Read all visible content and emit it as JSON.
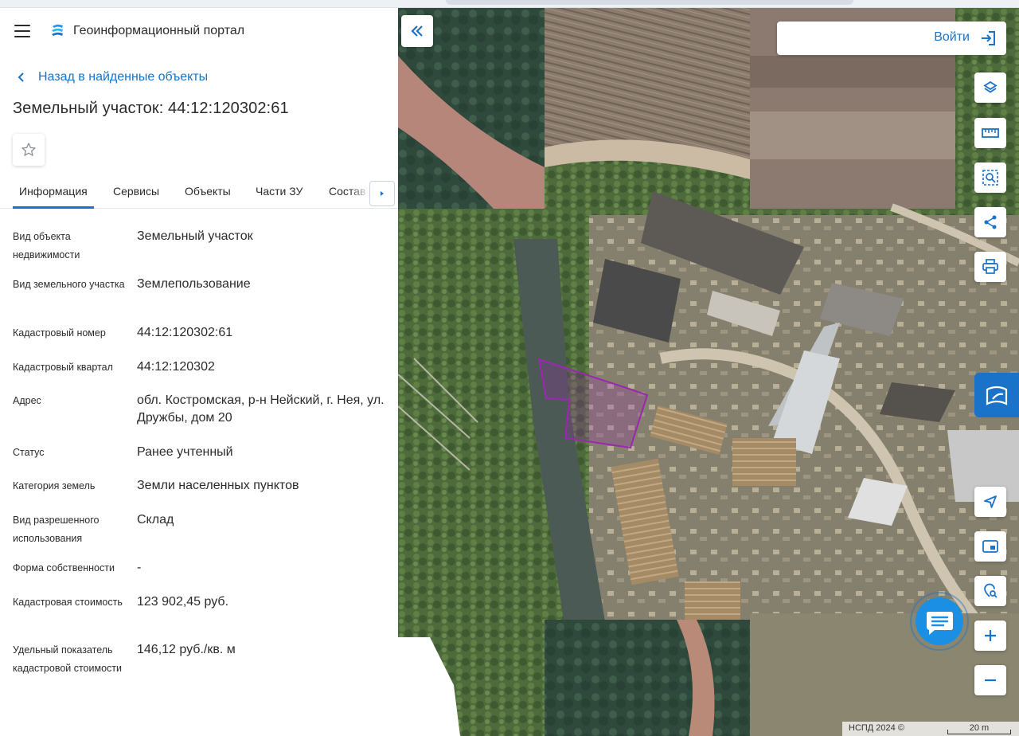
{
  "app": {
    "title": "Геоинформационный портал"
  },
  "panel": {
    "back_label": "Назад в найденные объекты",
    "object_title": "Земельный участок: 44:12:120302:61",
    "tabs": [
      {
        "label": "Информация",
        "active": true
      },
      {
        "label": "Сервисы",
        "active": false
      },
      {
        "label": "Объекты",
        "active": false
      },
      {
        "label": "Части ЗУ",
        "active": false
      },
      {
        "label": "Состав",
        "active": false
      }
    ],
    "info_rows": [
      {
        "label": "Вид объекта недвижимости",
        "value": "Земельный участок"
      },
      {
        "label": "Вид земельного участка",
        "value": "Землепользование"
      },
      {
        "label": "Кадастровый номер",
        "value": "44:12:120302:61"
      },
      {
        "label": "Кадастровый квартал",
        "value": "44:12:120302"
      },
      {
        "label": "Адрес",
        "value": "обл. Костромская, р-н Нейский, г. Нея, ул. Дружбы, дом 20"
      },
      {
        "label": "Статус",
        "value": "Ранее учтенный"
      },
      {
        "label": "Категория земель",
        "value": "Земли населенных пунктов"
      },
      {
        "label": "Вид разрешенного использования",
        "value": "Склад"
      },
      {
        "label": "Форма собственности",
        "value": "-"
      },
      {
        "label": "Кадастровая стоимость",
        "value": "123 902,45 руб."
      },
      {
        "label": "Удельный показатель кадастровой стоимости",
        "value": "146,12 руб./кв. м"
      }
    ]
  },
  "map": {
    "login_label": "Войти",
    "tools": [
      "layers-icon",
      "ruler-icon",
      "area-search-icon",
      "share-icon",
      "print-icon"
    ],
    "nav_tools": [
      "location-arrow-icon",
      "picture-in-picture-icon",
      "geo-search-icon",
      "zoom-in-icon",
      "zoom-out-icon"
    ],
    "attribution": "НСПД 2024 ©",
    "scale_label": "20 m",
    "colors": {
      "accent": "#1a73c9",
      "parcel_outline": "#9c27b0"
    }
  }
}
